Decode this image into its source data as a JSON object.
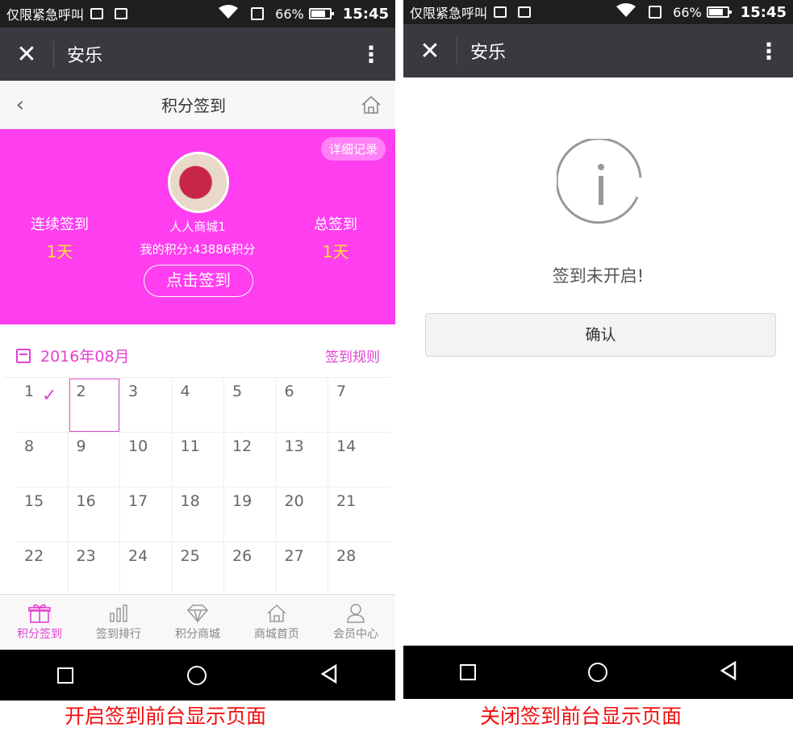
{
  "status_bar": {
    "carrier": "仅限紧急呼叫",
    "battery_pct": "66%",
    "time": "15:45"
  },
  "wechat_bar": {
    "title": "安乐",
    "close_icon": "close-icon",
    "more_icon": "more-vertical-icon"
  },
  "left": {
    "page_title": "积分签到",
    "detail_btn": "详细记录",
    "consecutive_label": "连续签到",
    "consecutive_value": "1天",
    "total_label": "总签到",
    "total_value": "1天",
    "user_name": "人人商城1",
    "points": "我的积分:43886积分",
    "sign_btn": "点击签到",
    "calendar": {
      "month": "2016年08月",
      "rules": "签到规则",
      "rows": [
        [
          "1",
          "2",
          "3",
          "4",
          "5",
          "6",
          "7"
        ],
        [
          "8",
          "9",
          "10",
          "11",
          "12",
          "13",
          "14"
        ],
        [
          "15",
          "16",
          "17",
          "18",
          "19",
          "20",
          "21"
        ],
        [
          "22",
          "23",
          "24",
          "25",
          "26",
          "27",
          "28"
        ]
      ],
      "signed_day": "1",
      "today": "2"
    },
    "tabs": [
      {
        "label": "积分签到",
        "icon": "gift-icon",
        "active": true
      },
      {
        "label": "签到排行",
        "icon": "bar-chart-icon",
        "active": false
      },
      {
        "label": "积分商城",
        "icon": "diamond-icon",
        "active": false
      },
      {
        "label": "商城首页",
        "icon": "home-icon",
        "active": false
      },
      {
        "label": "会员中心",
        "icon": "user-icon",
        "active": false
      }
    ],
    "accent_color": "#ff3ef0"
  },
  "right": {
    "message": "签到未开启!",
    "confirm_btn": "确认"
  },
  "captions": {
    "left": "开启签到前台显示页面",
    "right": "关闭签到前台显示页面"
  }
}
